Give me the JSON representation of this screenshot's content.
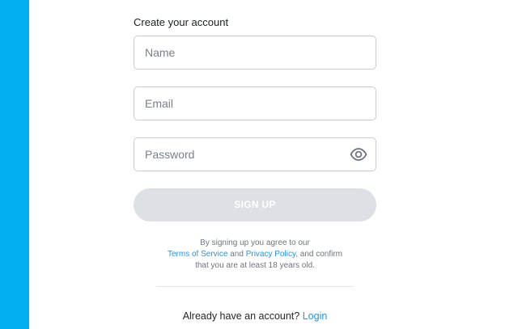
{
  "form": {
    "heading": "Create your account",
    "name_placeholder": "Name",
    "email_placeholder": "Email",
    "password_placeholder": "Password",
    "password_toggle_icon": "eye-icon",
    "signup_label": "SIGN UP"
  },
  "legal": {
    "prefix": "By signing up you agree to our",
    "terms_link": "Terms of Service",
    "and_text": "and",
    "privacy_link": "Privacy Policy",
    "suffix_1": ", and confirm",
    "suffix_2": "that you are at least 18 years old."
  },
  "footer": {
    "prompt": "Already have an account?",
    "login_link": "Login"
  },
  "colors": {
    "accent_bar": "#03aef0",
    "link": "#2a94d6",
    "button_disabled": "#dde0e4"
  }
}
